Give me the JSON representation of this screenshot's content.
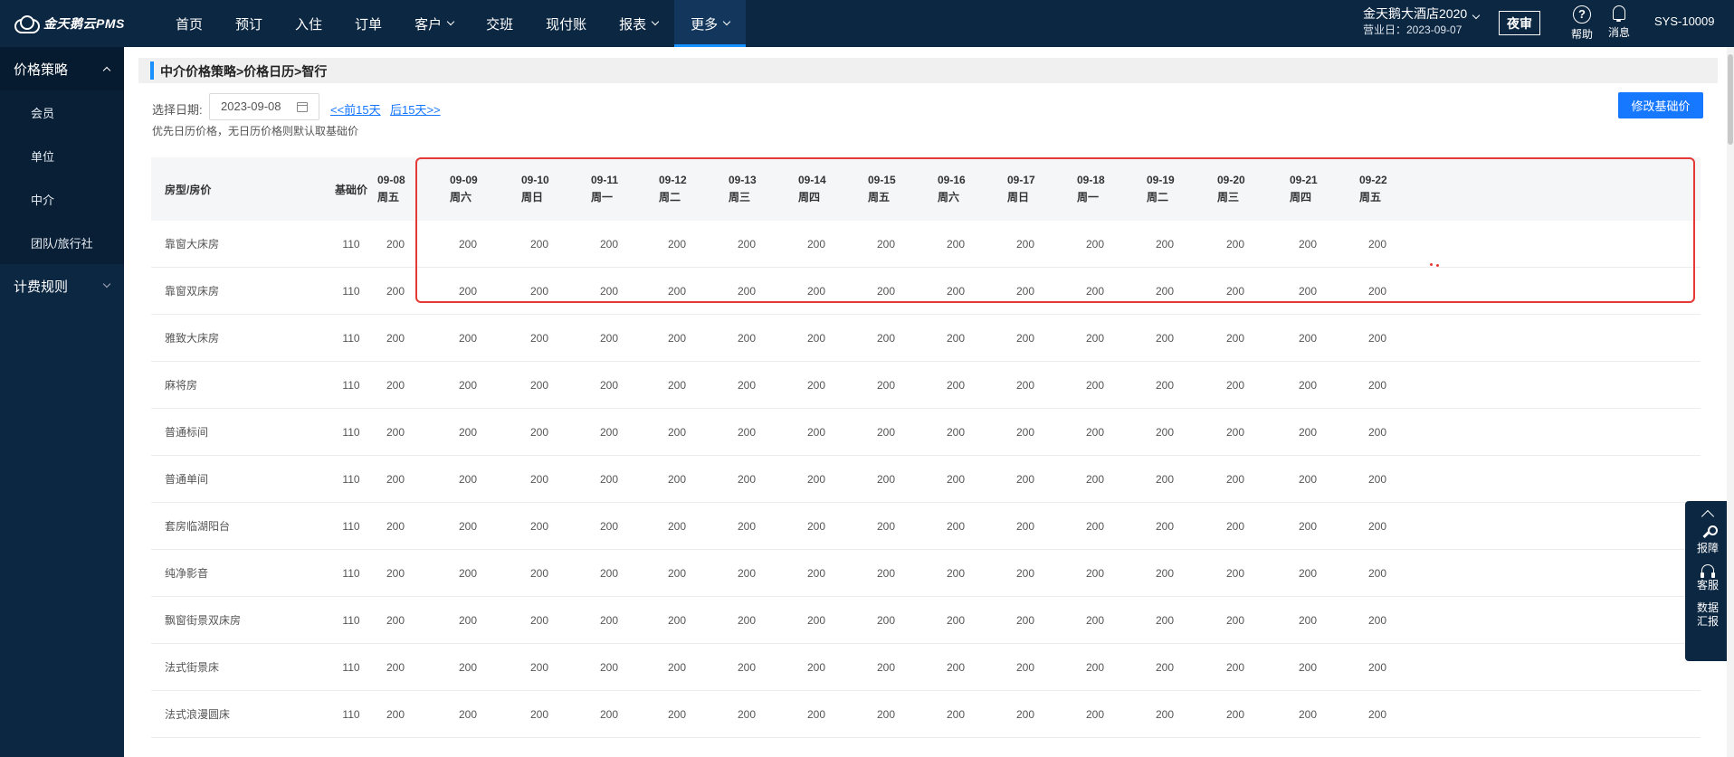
{
  "app": {
    "logo_text": "金天鹅云PMS"
  },
  "nav": [
    {
      "label": "首页",
      "caret": false,
      "active": false
    },
    {
      "label": "预订",
      "caret": false,
      "active": false
    },
    {
      "label": "入住",
      "caret": false,
      "active": false
    },
    {
      "label": "订单",
      "caret": false,
      "active": false
    },
    {
      "label": "客户",
      "caret": true,
      "active": false
    },
    {
      "label": "交班",
      "caret": false,
      "active": false
    },
    {
      "label": "现付账",
      "caret": false,
      "active": false
    },
    {
      "label": "报表",
      "caret": true,
      "active": false
    },
    {
      "label": "更多",
      "caret": true,
      "active": true
    }
  ],
  "header": {
    "hotel_name": "金天鹅大酒店2020",
    "business_day": "营业日：2023-09-07",
    "night_audit": "夜审",
    "help": "帮助",
    "help_glyph": "?",
    "messages": "消息",
    "user": "SYS-10009"
  },
  "sidebar": {
    "group1": "价格策略",
    "items": [
      "会员",
      "单位",
      "中介",
      "团队/旅行社"
    ],
    "group2": "计费规则"
  },
  "page": {
    "breadcrumb": "中介价格策略>价格日历>智行",
    "date_label": "选择日期:",
    "date_value": "2023-09-08",
    "prev_link": "<<前15天",
    "next_link": "后15天>>",
    "hint": "优先日历价格，无日历价格则默认取基础价",
    "modify_button": "修改基础价"
  },
  "table": {
    "col_room": "房型/房价",
    "col_base": "基础价",
    "days": [
      {
        "date": "09-08",
        "weekday": "周五"
      },
      {
        "date": "09-09",
        "weekday": "周六"
      },
      {
        "date": "09-10",
        "weekday": "周日"
      },
      {
        "date": "09-11",
        "weekday": "周一"
      },
      {
        "date": "09-12",
        "weekday": "周二"
      },
      {
        "date": "09-13",
        "weekday": "周三"
      },
      {
        "date": "09-14",
        "weekday": "周四"
      },
      {
        "date": "09-15",
        "weekday": "周五"
      },
      {
        "date": "09-16",
        "weekday": "周六"
      },
      {
        "date": "09-17",
        "weekday": "周日"
      },
      {
        "date": "09-18",
        "weekday": "周一"
      },
      {
        "date": "09-19",
        "weekday": "周二"
      },
      {
        "date": "09-20",
        "weekday": "周三"
      },
      {
        "date": "09-21",
        "weekday": "周四"
      },
      {
        "date": "09-22",
        "weekday": "周五"
      }
    ],
    "rows": [
      {
        "name": "靠窗大床房",
        "base": "110",
        "prices": [
          "200",
          "200",
          "200",
          "200",
          "200",
          "200",
          "200",
          "200",
          "200",
          "200",
          "200",
          "200",
          "200",
          "200",
          "200"
        ]
      },
      {
        "name": "靠窗双床房",
        "base": "110",
        "prices": [
          "200",
          "200",
          "200",
          "200",
          "200",
          "200",
          "200",
          "200",
          "200",
          "200",
          "200",
          "200",
          "200",
          "200",
          "200"
        ]
      },
      {
        "name": "雅致大床房",
        "base": "110",
        "prices": [
          "200",
          "200",
          "200",
          "200",
          "200",
          "200",
          "200",
          "200",
          "200",
          "200",
          "200",
          "200",
          "200",
          "200",
          "200"
        ]
      },
      {
        "name": "麻将房",
        "base": "110",
        "prices": [
          "200",
          "200",
          "200",
          "200",
          "200",
          "200",
          "200",
          "200",
          "200",
          "200",
          "200",
          "200",
          "200",
          "200",
          "200"
        ]
      },
      {
        "name": "普通标间",
        "base": "110",
        "prices": [
          "200",
          "200",
          "200",
          "200",
          "200",
          "200",
          "200",
          "200",
          "200",
          "200",
          "200",
          "200",
          "200",
          "200",
          "200"
        ]
      },
      {
        "name": "普通单间",
        "base": "110",
        "prices": [
          "200",
          "200",
          "200",
          "200",
          "200",
          "200",
          "200",
          "200",
          "200",
          "200",
          "200",
          "200",
          "200",
          "200",
          "200"
        ]
      },
      {
        "name": "套房临湖阳台",
        "base": "110",
        "prices": [
          "200",
          "200",
          "200",
          "200",
          "200",
          "200",
          "200",
          "200",
          "200",
          "200",
          "200",
          "200",
          "200",
          "200",
          "200"
        ]
      },
      {
        "name": "纯净影音",
        "base": "110",
        "prices": [
          "200",
          "200",
          "200",
          "200",
          "200",
          "200",
          "200",
          "200",
          "200",
          "200",
          "200",
          "200",
          "200",
          "200",
          "200"
        ]
      },
      {
        "name": "飘窗街景双床房",
        "base": "110",
        "prices": [
          "200",
          "200",
          "200",
          "200",
          "200",
          "200",
          "200",
          "200",
          "200",
          "200",
          "200",
          "200",
          "200",
          "200",
          "200"
        ]
      },
      {
        "name": "法式街景床",
        "base": "110",
        "prices": [
          "200",
          "200",
          "200",
          "200",
          "200",
          "200",
          "200",
          "200",
          "200",
          "200",
          "200",
          "200",
          "200",
          "200",
          "200"
        ]
      },
      {
        "name": "法式浪漫圆床",
        "base": "110",
        "prices": [
          "200",
          "200",
          "200",
          "200",
          "200",
          "200",
          "200",
          "200",
          "200",
          "200",
          "200",
          "200",
          "200",
          "200",
          "200"
        ]
      }
    ]
  },
  "float_panel": {
    "report_issue": "报障",
    "service": "客服",
    "data_report_1": "数据",
    "data_report_2": "汇报"
  },
  "colors": {
    "nav_bg": "#0c2742",
    "accent": "#1677ff",
    "highlight": "#e53935"
  }
}
